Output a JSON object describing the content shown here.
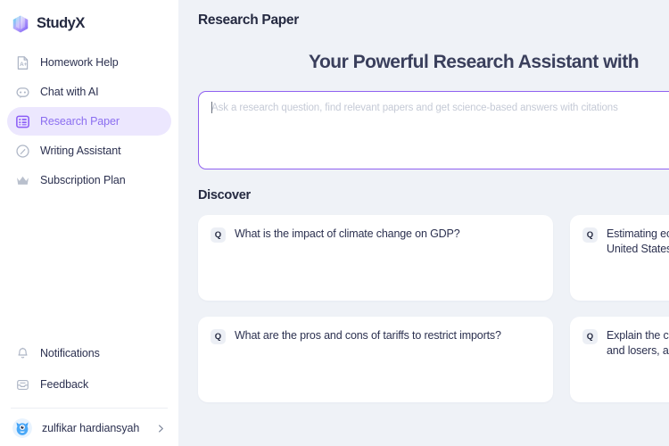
{
  "brand": {
    "name": "StudyX",
    "logo_icon": "studyx-cube-logo",
    "colors": {
      "gradient_start": "#5ee0f0",
      "gradient_mid": "#a78bfa",
      "gradient_end": "#7c5cf5"
    }
  },
  "sidebar": {
    "items": [
      {
        "label": "Homework Help",
        "icon": "document-a-plus-icon",
        "active": false
      },
      {
        "label": "Chat with AI",
        "icon": "robot-chat-icon",
        "active": false
      },
      {
        "label": "Research Paper",
        "icon": "list-grid-icon",
        "active": true
      },
      {
        "label": "Writing Assistant",
        "icon": "pencil-circle-icon",
        "active": false
      },
      {
        "label": "Subscription Plan",
        "icon": "crown-icon",
        "active": false
      }
    ],
    "bottom_items": [
      {
        "label": "Notifications",
        "icon": "bell-icon"
      },
      {
        "label": "Feedback",
        "icon": "inbox-tray-icon"
      }
    ],
    "user": {
      "name": "zulfikar hardiansyah",
      "avatar_icon": "monster-avatar",
      "chevron_icon": "chevron-right-icon"
    },
    "active_color": "#8b6ef0",
    "active_bg": "#ece7fe"
  },
  "main": {
    "page_title": "Research Paper",
    "hero_heading": "Your Powerful Research Assistant with",
    "search": {
      "placeholder": "Ask a research question, find relevant papers and get science-based answers with citations",
      "value": "",
      "border_color": "#9061f0",
      "focused": true
    },
    "discover": {
      "title": "Discover",
      "cards": [
        {
          "badge": "Q",
          "text": "What is the impact of climate change on GDP?"
        },
        {
          "badge": "Q",
          "text": "Estimating economic damages from climate change in the United States"
        },
        {
          "badge": "Q",
          "text": "What are the pros and cons of tariffs to restrict imports?"
        },
        {
          "badge": "Q",
          "text": "Explain the common arguments about tariffs, including winners and losers, and the effects on the economy"
        }
      ]
    }
  }
}
